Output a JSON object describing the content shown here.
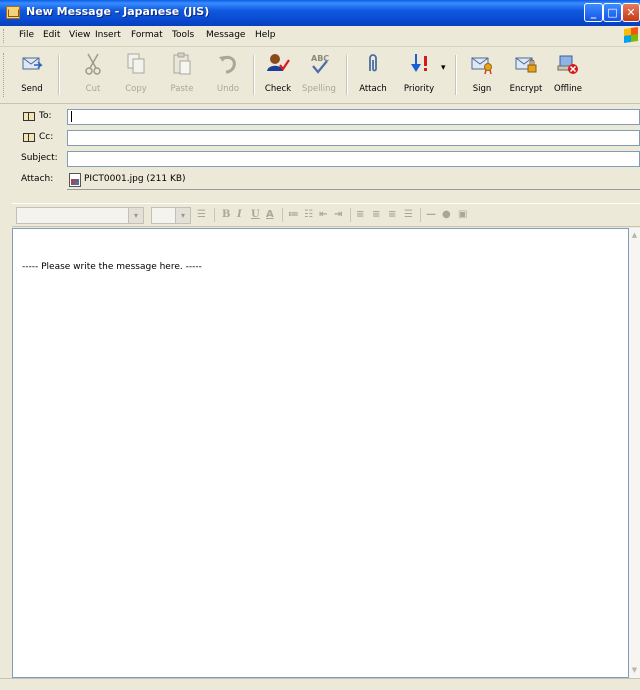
{
  "window": {
    "title": "New Message - Japanese (JIS)"
  },
  "menu": [
    "File",
    "Edit",
    "View",
    "Insert",
    "Format",
    "Tools",
    "Message",
    "Help"
  ],
  "toolbar": {
    "buttons": [
      {
        "label": "Send",
        "icon": "send-icon"
      },
      {
        "label": "Cut",
        "icon": "cut-icon"
      },
      {
        "label": "Copy",
        "icon": "copy-icon"
      },
      {
        "label": "Paste",
        "icon": "paste-icon"
      },
      {
        "label": "Undo",
        "icon": "undo-icon"
      },
      {
        "label": "Check",
        "icon": "check-names-icon"
      },
      {
        "label": "Spelling",
        "icon": "spelling-icon"
      },
      {
        "label": "Attach",
        "icon": "paperclip-icon"
      },
      {
        "label": "Priority",
        "icon": "priority-icon"
      },
      {
        "label": "Sign",
        "icon": "sign-icon"
      },
      {
        "label": "Encrypt",
        "icon": "encrypt-icon"
      },
      {
        "label": "Offline",
        "icon": "offline-icon"
      }
    ]
  },
  "fields": {
    "to_label": "To:",
    "to_value": "",
    "cc_label": "Cc:",
    "cc_value": "",
    "subject_label": "Subject:",
    "subject_value": "",
    "attach_label": "Attach:",
    "attachment": "PICT0001.jpg (211 KB)"
  },
  "format_bar": {
    "font_name": "",
    "font_size": "",
    "icons": [
      "paragraph-style-icon",
      "bold-icon",
      "italic-icon",
      "underline-icon",
      "font-color-icon",
      "numbered-list-icon",
      "bullet-list-icon",
      "decrease-indent-icon",
      "increase-indent-icon",
      "align-left-icon",
      "align-center-icon",
      "align-right-icon",
      "justify-icon",
      "horizontal-line-icon",
      "hyperlink-icon",
      "insert-picture-icon"
    ]
  },
  "body": {
    "text": "----- Please write the message here. -----"
  },
  "colors": {
    "title_blue": "#0a5ce6",
    "chrome": "#ece9d8",
    "input_border": "#7f9db9",
    "priority_blue": "#1b5fd6",
    "offline_red": "#d01c1c"
  }
}
